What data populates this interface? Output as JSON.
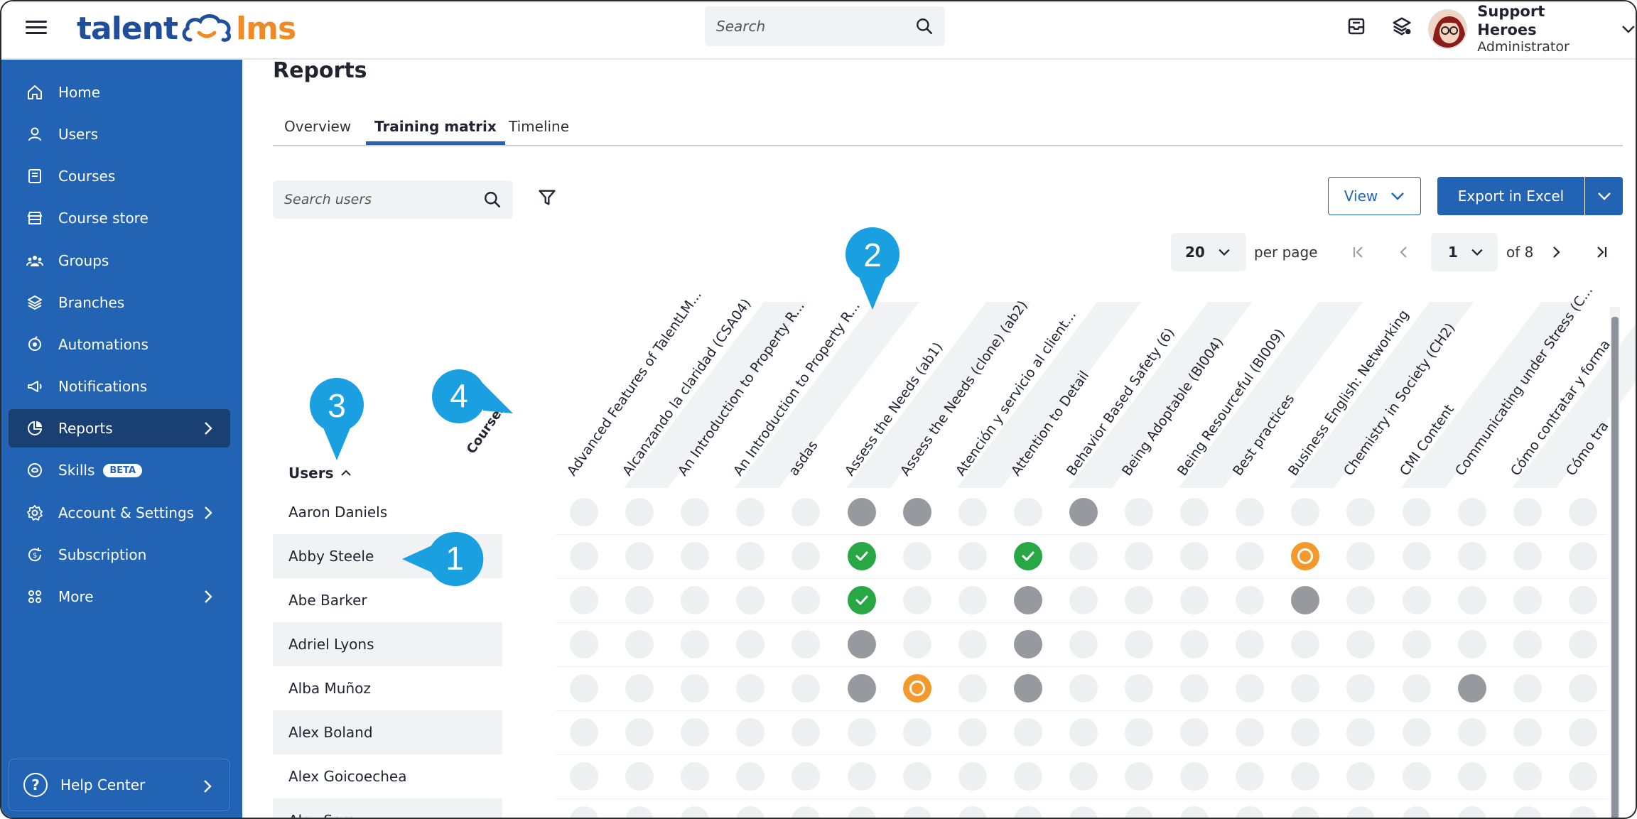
{
  "app": {
    "logo_left": "talent",
    "logo_right": "lms"
  },
  "topbar": {
    "search_placeholder": "Search",
    "user_name": "Support Heroes",
    "user_role": "Administrator"
  },
  "sidebar": {
    "items": [
      {
        "label": "Home",
        "icon": "home-icon"
      },
      {
        "label": "Users",
        "icon": "user-icon"
      },
      {
        "label": "Courses",
        "icon": "book-icon"
      },
      {
        "label": "Course store",
        "icon": "store-icon"
      },
      {
        "label": "Groups",
        "icon": "group-icon"
      },
      {
        "label": "Branches",
        "icon": "layers-icon"
      },
      {
        "label": "Automations",
        "icon": "automation-icon"
      },
      {
        "label": "Notifications",
        "icon": "megaphone-icon"
      },
      {
        "label": "Reports",
        "icon": "pie-chart-icon",
        "active": true
      },
      {
        "label": "Skills",
        "icon": "skills-icon",
        "badge": "BETA"
      },
      {
        "label": "Account & Settings",
        "icon": "gear-icon"
      },
      {
        "label": "Subscription",
        "icon": "subscription-icon"
      },
      {
        "label": "More",
        "icon": "grid-icon"
      }
    ],
    "help_label": "Help Center"
  },
  "main": {
    "title": "Reports",
    "tabs": [
      "Overview",
      "Training matrix",
      "Timeline"
    ],
    "active_tab": "Training matrix",
    "search_users_placeholder": "Search users",
    "view_label": "View",
    "export_label": "Export in Excel",
    "per_page_value": "20",
    "per_page_label": "per page",
    "page_value": "1",
    "of_pages": "of 8"
  },
  "matrix": {
    "users_header": "Users",
    "courses_header": "Courses",
    "courses": [
      "Advanced Features of TalentLM...",
      "Alcanzando la claridad (CSA04)",
      "An Introduction to Property R...",
      "An Introduction to Property R...",
      "asdas",
      "Assess the Needs (ab1)",
      "Assess the Needs (clone) (ab2)",
      "Atención y servicio al client...",
      "Attention to Detail",
      "Behavior Based Safety (6)",
      "Being Adoptable (BI004)",
      "Being Resourceful (BI009)",
      "Best practices",
      "Business English: Networking",
      "Chemistry in Society (CH2)",
      "CMI Content",
      "Communicating under Stress (C...",
      "Cómo contratar y forma",
      "Cómo tra"
    ],
    "users": [
      "Aaron Daniels",
      "Abby Steele",
      "Abe Barker",
      "Adriel Lyons",
      "Alba Muñoz",
      "Alex Boland",
      "Alex Goicoechea",
      "Alex Sero"
    ],
    "status": [
      [
        "e",
        "e",
        "e",
        "e",
        "e",
        "g",
        "g",
        "e",
        "e",
        "g",
        "e",
        "e",
        "e",
        "e",
        "e",
        "e",
        "e",
        "e",
        "e"
      ],
      [
        "e",
        "e",
        "e",
        "e",
        "e",
        "c",
        "e",
        "e",
        "c",
        "e",
        "e",
        "e",
        "e",
        "o",
        "e",
        "e",
        "e",
        "e",
        "e"
      ],
      [
        "e",
        "e",
        "e",
        "e",
        "e",
        "c",
        "e",
        "e",
        "g",
        "e",
        "e",
        "e",
        "e",
        "g",
        "e",
        "e",
        "e",
        "e",
        "e"
      ],
      [
        "e",
        "e",
        "e",
        "e",
        "e",
        "g",
        "e",
        "e",
        "g",
        "e",
        "e",
        "e",
        "e",
        "e",
        "e",
        "e",
        "e",
        "e",
        "e"
      ],
      [
        "e",
        "e",
        "e",
        "e",
        "e",
        "g",
        "o",
        "e",
        "g",
        "e",
        "e",
        "e",
        "e",
        "e",
        "e",
        "e",
        "g",
        "e",
        "e"
      ],
      [
        "e",
        "e",
        "e",
        "e",
        "e",
        "e",
        "e",
        "e",
        "e",
        "e",
        "e",
        "e",
        "e",
        "e",
        "e",
        "e",
        "e",
        "e",
        "e"
      ],
      [
        "e",
        "e",
        "e",
        "e",
        "e",
        "e",
        "e",
        "e",
        "e",
        "e",
        "e",
        "e",
        "e",
        "e",
        "e",
        "e",
        "e",
        "e",
        "e"
      ],
      [
        "e",
        "e",
        "e",
        "e",
        "e",
        "e",
        "e",
        "e",
        "e",
        "e",
        "e",
        "e",
        "e",
        "e",
        "e",
        "e",
        "e",
        "e",
        "e"
      ]
    ],
    "status_legend": {
      "e": "not-started",
      "g": "in-progress",
      "c": "completed",
      "o": "failed"
    }
  },
  "callouts": [
    "1",
    "2",
    "3",
    "4"
  ],
  "colors": {
    "brand_blue": "#2263b3",
    "brand_orange": "#f08a24",
    "sidebar_active": "#1a3f73",
    "completed": "#28a745",
    "in_progress": "#969a9f",
    "failed": "#f49a2c",
    "callout": "#1aa0e0"
  }
}
